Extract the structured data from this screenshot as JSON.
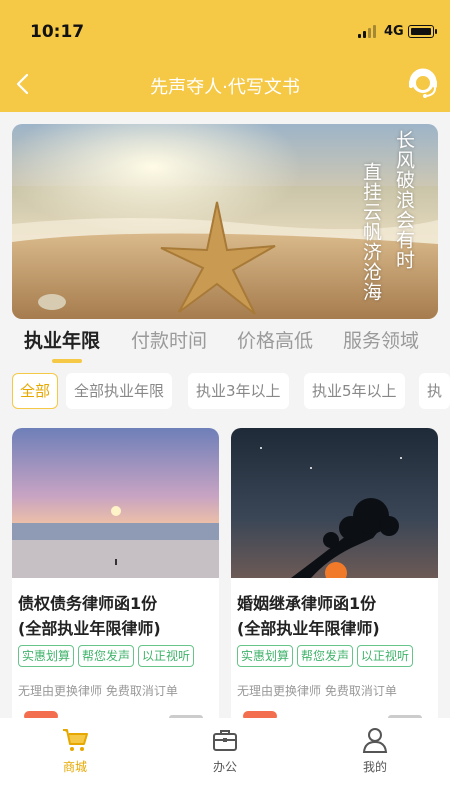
{
  "status_bar": {
    "time": "10:17",
    "network": "4G"
  },
  "header": {
    "title": "先声夺人·代写文书"
  },
  "banner": {
    "poem_lines": [
      "长风破浪会有时",
      "直挂云帆济沧海"
    ]
  },
  "sort_tabs": [
    {
      "label": "执业年限",
      "active": true
    },
    {
      "label": "付款时间",
      "active": false
    },
    {
      "label": "价格高低",
      "active": false
    },
    {
      "label": "服务领域",
      "active": false
    }
  ],
  "filter_chips": [
    {
      "label": "全部",
      "active": true
    },
    {
      "label": "全部执业年限",
      "active": false
    },
    {
      "label": "执业3年以上",
      "active": false
    },
    {
      "label": "执业5年以上",
      "active": false
    },
    {
      "label": "执",
      "active": false
    }
  ],
  "products": [
    {
      "name_line1": "债权债务律师函1份",
      "name_line2": "(全部执业年限律师)",
      "tags": [
        "实惠划算",
        "帮您发声",
        "以正视听"
      ],
      "note": "无理由更换律师 免费取消订单"
    },
    {
      "name_line1": "婚姻继承律师函1份",
      "name_line2": "(全部执业年限律师)",
      "tags": [
        "实惠划算",
        "帮您发声",
        "以正视听"
      ],
      "note": "无理由更换律师 免费取消订单"
    }
  ],
  "tab_bar": [
    {
      "label": "商城",
      "icon": "cart-icon",
      "active": true
    },
    {
      "label": "办公",
      "icon": "briefcase-icon",
      "active": false
    },
    {
      "label": "我的",
      "icon": "person-icon",
      "active": false
    }
  ],
  "colors": {
    "brand": "#f5c846",
    "tag_green": "#41b36b",
    "price_red": "#f04a22"
  }
}
